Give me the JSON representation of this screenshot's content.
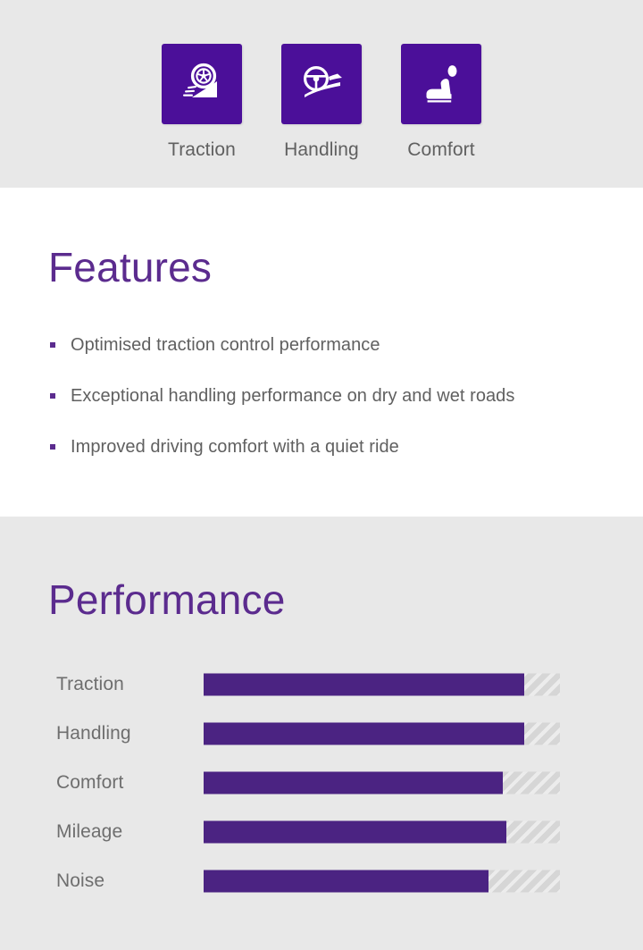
{
  "icon_strip": {
    "items": [
      {
        "label": "Traction",
        "icon": "tyre-wheel-road-icon"
      },
      {
        "label": "Handling",
        "icon": "steering-wheel-road-icon"
      },
      {
        "label": "Comfort",
        "icon": "car-seat-icon"
      }
    ]
  },
  "features": {
    "title": "Features",
    "items": [
      "Optimised traction control performance",
      "Exceptional handling performance on dry and wet roads",
      "Improved driving comfort with a quiet ride"
    ]
  },
  "performance": {
    "title": "Performance",
    "rows": [
      {
        "label": "Traction",
        "percent": 90
      },
      {
        "label": "Handling",
        "percent": 90
      },
      {
        "label": "Comfort",
        "percent": 84
      },
      {
        "label": "Mileage",
        "percent": 85
      },
      {
        "label": "Noise",
        "percent": 80
      }
    ]
  },
  "colors": {
    "brand_purple": "#4b0f99",
    "title_purple": "#5b2b8e",
    "bar_fill": "#4b2382",
    "bar_track": "#d6d6d6",
    "section_grey": "#e8e8e8",
    "text_grey": "#606060"
  },
  "chart_data": {
    "type": "bar",
    "title": "Performance",
    "categories": [
      "Traction",
      "Handling",
      "Comfort",
      "Mileage",
      "Noise"
    ],
    "values": [
      90,
      90,
      84,
      85,
      80
    ],
    "xlabel": "",
    "ylabel": "",
    "ylim": [
      0,
      100
    ],
    "orientation": "horizontal",
    "grid": false,
    "legend": false
  }
}
